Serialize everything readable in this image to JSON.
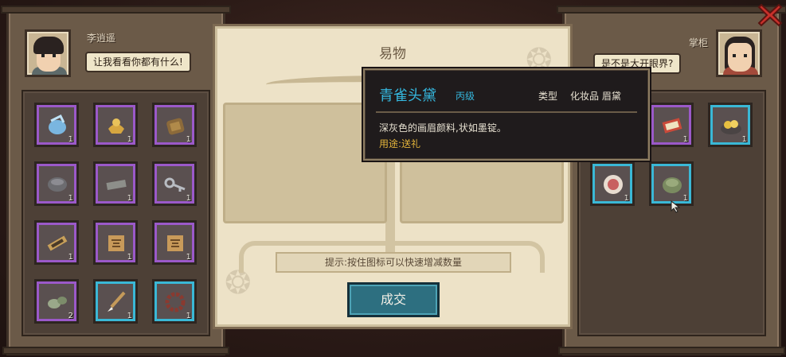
{
  "left_panel": {
    "speaker_name": "李逍遥",
    "speech": "让我看看你都有什么!",
    "items": [
      {
        "icon": "blue-sachet-icon",
        "qty": "1",
        "rarity": "purple"
      },
      {
        "icon": "gold-ingot-icon",
        "qty": "1",
        "rarity": "purple"
      },
      {
        "icon": "bronze-tablet-icon",
        "qty": "1",
        "rarity": "purple"
      },
      {
        "icon": "grey-bowl-icon",
        "qty": "1",
        "rarity": "purple"
      },
      {
        "icon": "grey-bar-icon",
        "qty": "1",
        "rarity": "purple"
      },
      {
        "icon": "silver-key-icon",
        "qty": "1",
        "rarity": "purple"
      },
      {
        "icon": "scroll-icon",
        "qty": "1",
        "rarity": "purple"
      },
      {
        "icon": "tile-map-icon",
        "qty": "1",
        "rarity": "purple"
      },
      {
        "icon": "tile-map-icon",
        "qty": "1",
        "rarity": "purple"
      },
      {
        "icon": "green-gourd-icon",
        "qty": "2",
        "rarity": "purple"
      },
      {
        "icon": "brush-icon",
        "qty": "1",
        "rarity": "cyan"
      },
      {
        "icon": "prayer-beads-icon",
        "qty": "1",
        "rarity": "cyan"
      }
    ]
  },
  "right_panel": {
    "speaker_name": "掌柜",
    "speech": "是不是大开眼界?",
    "items": [
      {
        "icon": "dark-ink-stick-icon",
        "qty": "",
        "rarity": "purple"
      },
      {
        "icon": "red-book-icon",
        "qty": "1",
        "rarity": "purple"
      },
      {
        "icon": "gold-nuggets-icon",
        "qty": "1",
        "rarity": "cyan"
      },
      {
        "icon": "cake-plate-icon",
        "qty": "1",
        "rarity": "cyan"
      },
      {
        "icon": "green-jade-disc-icon",
        "qty": "1",
        "rarity": "cyan"
      }
    ]
  },
  "center": {
    "title": "易物",
    "hint": "提示:按住图标可以快速增减数量",
    "deal_label": "成交"
  },
  "tooltip": {
    "name": "青雀头黛",
    "grade": "丙级",
    "type_label": "类型",
    "type_value": "化妆品 眉黛",
    "description": "深灰色的画眉颜料,状如墨锭。",
    "usage": "用途:送礼"
  },
  "colors": {
    "rarity_purple": "#9b59c9",
    "rarity_cyan": "#3ab8d6",
    "tooltip_name": "#35b7de",
    "usage_text": "#e3b43a",
    "deal_button": "#2d6f80"
  }
}
